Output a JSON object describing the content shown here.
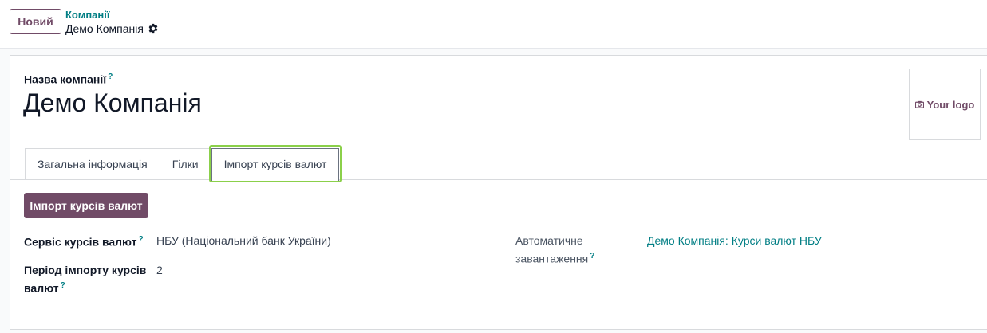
{
  "control_panel": {
    "new_button": "Новий",
    "breadcrumb_parent": "Компанії",
    "breadcrumb_current": "Демо Компанія",
    "gear_icon": "gear-icon"
  },
  "form": {
    "company_name_label": "Назва компанії",
    "help_mark": "?",
    "company_name": "Демо Компанія",
    "logo_placeholder": "Your logo",
    "tabs": [
      {
        "label": "Загальна інформація",
        "active": false
      },
      {
        "label": "Гілки",
        "active": false
      },
      {
        "label": "Імпорт курсів валют",
        "active": true
      }
    ],
    "import_button": "Імпорт курсів валют",
    "fields": {
      "rate_service_label": "Сервіс курсів валют",
      "rate_service_value": "НБУ (Національний банк України)",
      "import_period_label_line1": "Період імпорту курсів",
      "import_period_label_line2": "валют",
      "import_period_value": "2",
      "auto_load_label_line1": "Автоматичне",
      "auto_load_label_line2": "завантаження",
      "auto_load_value": "Демо Компанія: Курси валют НБУ"
    }
  },
  "colors": {
    "brand": "#714b67",
    "link": "#017e84",
    "highlight": "#8bd04a"
  }
}
